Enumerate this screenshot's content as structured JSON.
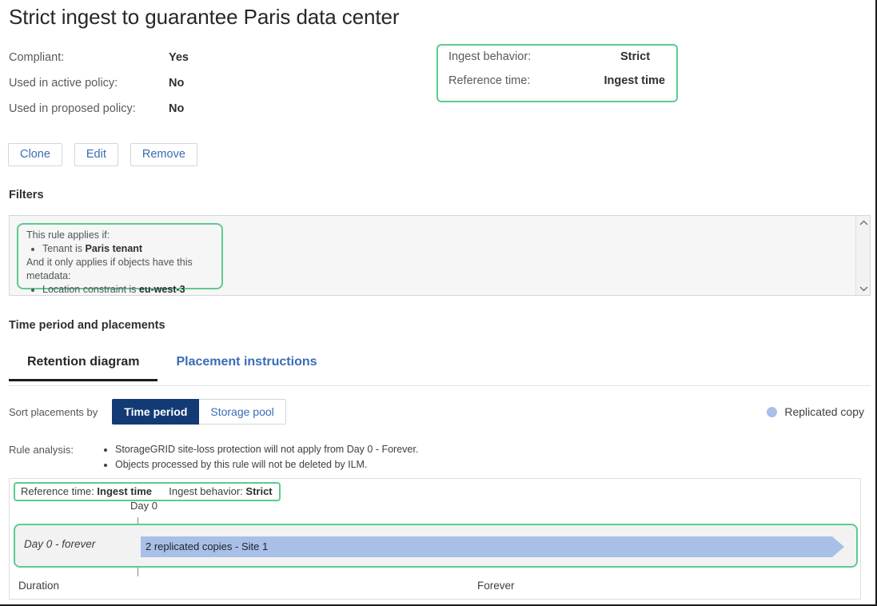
{
  "page": {
    "title": "Strict ingest to guarantee Paris data center"
  },
  "summary": {
    "rows": [
      {
        "label": "Compliant:",
        "value": "Yes"
      },
      {
        "label": "Used in active policy:",
        "value": "No"
      },
      {
        "label": "Used in proposed policy:",
        "value": "No"
      }
    ]
  },
  "ingest_box": {
    "rows": [
      {
        "label": "Ingest behavior:",
        "value": "Strict"
      },
      {
        "label": "Reference time:",
        "value": "Ingest time"
      }
    ],
    "border_color": "#5ecb8e"
  },
  "actions": {
    "clone": "Clone",
    "edit": "Edit",
    "remove": "Remove"
  },
  "filters": {
    "heading": "Filters",
    "intro": "This rule applies if:",
    "rule_items": [
      {
        "prefix": "Tenant is ",
        "bold": "Paris tenant"
      }
    ],
    "metadata_intro": "And it only applies if objects have this metadata:",
    "metadata_items": [
      {
        "prefix": "Location constraint is ",
        "bold": "eu-west-3"
      }
    ],
    "scrollbar": {
      "up_icon": "chevron-up-icon",
      "down_icon": "chevron-down-icon"
    }
  },
  "time_period": {
    "heading": "Time period and placements",
    "tabs": [
      {
        "label": "Retention diagram",
        "active": true
      },
      {
        "label": "Placement instructions",
        "active": false
      }
    ],
    "sort": {
      "label": "Sort placements by",
      "options": [
        {
          "label": "Time period",
          "selected": true
        },
        {
          "label": "Storage pool",
          "selected": false
        }
      ]
    },
    "legend": {
      "icon": "circle-icon",
      "label": "Replicated copy",
      "color": "#a8c0e8"
    },
    "analysis": {
      "label": "Rule analysis:",
      "items": [
        "StorageGRID site-loss protection will not apply from Day 0 - Forever.",
        "Objects processed by this rule will not be deleted by ILM."
      ]
    }
  },
  "diagram": {
    "reference": {
      "ref_label": "Reference time:",
      "ref_value": "Ingest time",
      "behavior_label": "Ingest behavior:",
      "behavior_value": "Strict"
    },
    "day0_label": "Day 0",
    "period_name": "Day 0 - forever",
    "bar_label": "2 replicated copies - Site 1",
    "bar_color": "#a8c0e8",
    "duration_label": "Duration",
    "forever_label": "Forever"
  }
}
